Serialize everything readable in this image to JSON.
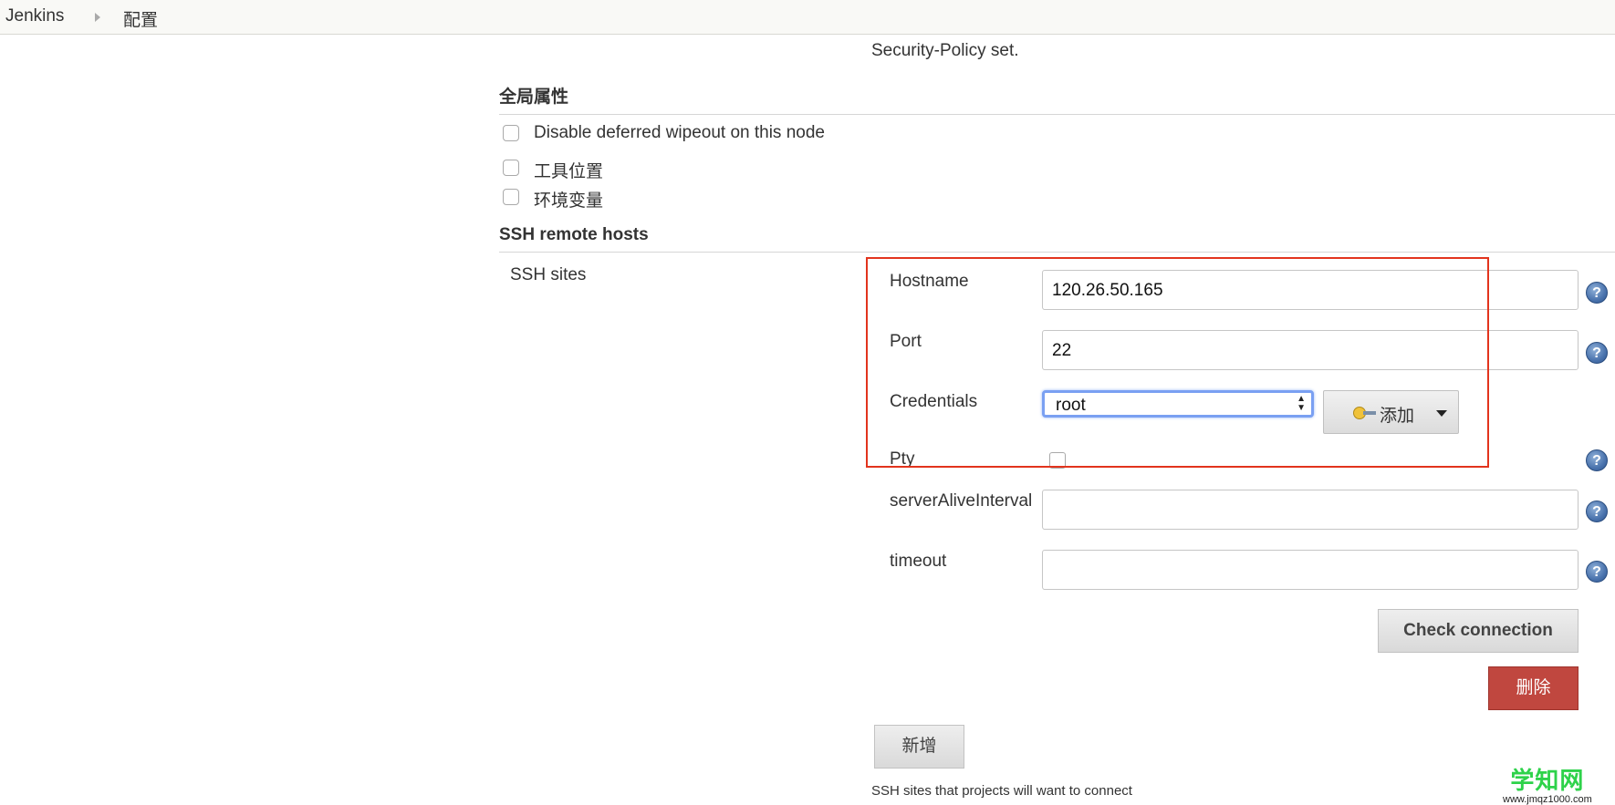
{
  "breadcrumb": {
    "home": "Jenkins",
    "current": "配置"
  },
  "security_policy_text": "Security-Policy set.",
  "global_properties": {
    "title": "全局属性",
    "options": [
      {
        "label": "Disable deferred wipeout on this node",
        "checked": false
      },
      {
        "label": "工具位置",
        "checked": false
      },
      {
        "label": "环境变量",
        "checked": false
      }
    ]
  },
  "ssh_remote_hosts": {
    "title": "SSH remote hosts",
    "sites_label": "SSH sites",
    "fields": {
      "hostname": {
        "label": "Hostname",
        "value": "120.26.50.165"
      },
      "port": {
        "label": "Port",
        "value": "22"
      },
      "credentials": {
        "label": "Credentials",
        "value": "root",
        "add_label": "添加"
      },
      "pty": {
        "label": "Pty",
        "checked": false
      },
      "server_alive_interval": {
        "label": "serverAliveInterval",
        "value": ""
      },
      "timeout": {
        "label": "timeout",
        "value": ""
      }
    },
    "check_connection_label": "Check connection",
    "delete_label": "删除",
    "add_new_label": "新增",
    "help_text": "SSH sites that projects will want to connect"
  },
  "help_icon_glyph": "?",
  "watermark": {
    "main": "学知网",
    "sub": "www.jmqz1000.com"
  },
  "colors": {
    "highlight": "#e2341d",
    "delete_button": "#c0473f",
    "watermark": "#2ed24a",
    "select_focus": "#7aa0f2"
  }
}
